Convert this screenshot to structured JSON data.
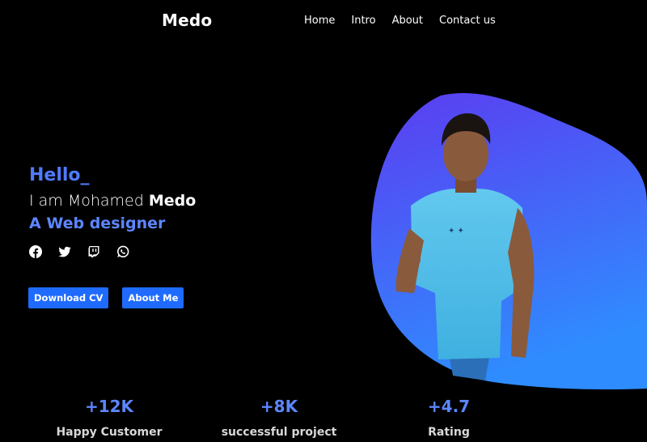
{
  "nav": {
    "brand": "Medo",
    "links": [
      "Home",
      "Intro",
      "About",
      "Contact us"
    ]
  },
  "hero": {
    "hello": "Hello_",
    "intro_prefix": "I am Mohamed ",
    "intro_name": "Medo",
    "role": "A Web designer",
    "socials": [
      "facebook-icon",
      "twitter-icon",
      "twitch-icon",
      "whatsapp-icon"
    ],
    "buttons": {
      "download": "Download CV",
      "about": "About Me"
    }
  },
  "stats": [
    {
      "value": "+12K",
      "label": "Happy Customer"
    },
    {
      "value": "+8K",
      "label": "successful project"
    },
    {
      "value": "+4.7",
      "label": "Rating"
    }
  ],
  "colors": {
    "background": "#000000",
    "accent": "#1f6bff",
    "accent_text": "#5c86ff",
    "blob_top": "#5b3df0",
    "blob_bottom": "#2f8cff"
  }
}
